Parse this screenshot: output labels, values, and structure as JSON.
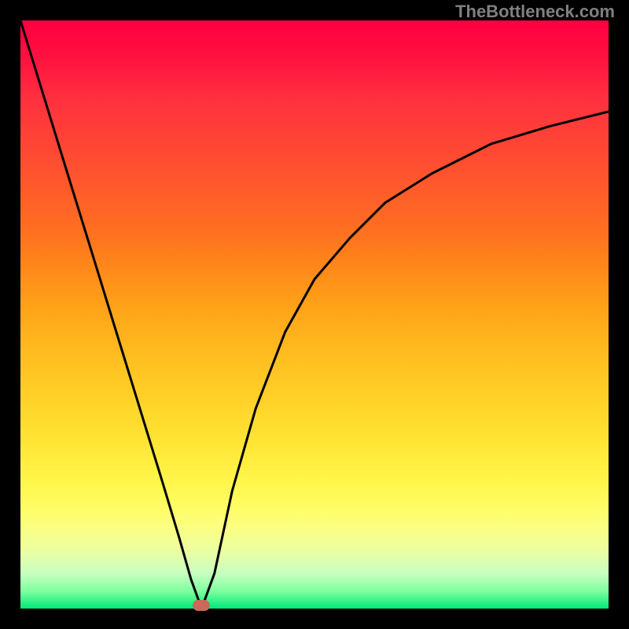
{
  "watermark": "TheBottleneck.com",
  "chart_data": {
    "type": "line",
    "title": "",
    "xlabel": "",
    "ylabel": "",
    "xlim": [
      0,
      100
    ],
    "ylim": [
      0,
      100
    ],
    "background_gradient": {
      "top": "#ff0040",
      "mid_high": "#ff8818",
      "mid": "#ffe030",
      "mid_low": "#fcff80",
      "bottom": "#00e878"
    },
    "series": [
      {
        "name": "bottleneck-curve",
        "color": "#000000",
        "x": [
          0,
          4,
          8,
          12,
          16,
          20,
          24,
          27,
          29,
          30.8,
          33,
          36,
          40,
          45,
          50,
          56,
          62,
          70,
          80,
          90,
          100
        ],
        "y": [
          100,
          87,
          74,
          61,
          48,
          35,
          22,
          12,
          5,
          0,
          6,
          20,
          34,
          47,
          56,
          63,
          69,
          74,
          79,
          82,
          84.5
        ]
      }
    ],
    "marker": {
      "name": "optimal-point",
      "x": 30.8,
      "y": 0.5,
      "color": "#c96a5a"
    }
  }
}
